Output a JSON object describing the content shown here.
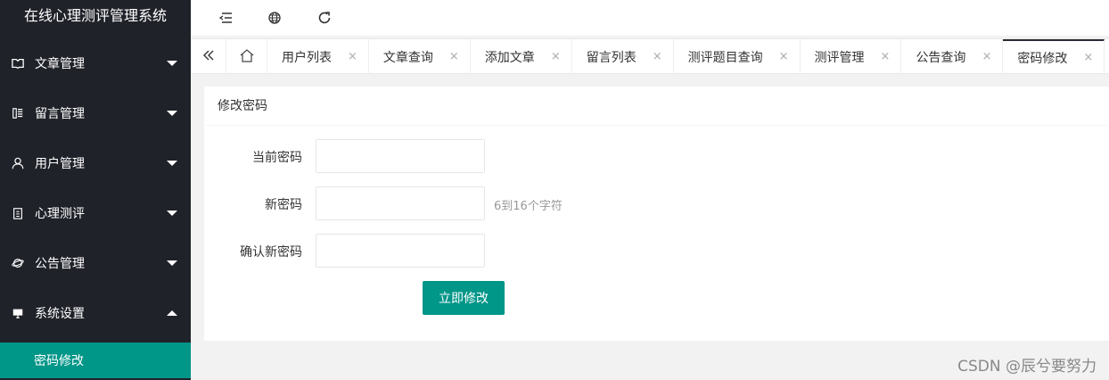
{
  "app": {
    "title": "在线心理测评管理系统"
  },
  "sidebar": {
    "items": [
      {
        "label": "文章管理",
        "icon": "book-icon"
      },
      {
        "label": "留言管理",
        "icon": "message-icon"
      },
      {
        "label": "用户管理",
        "icon": "user-icon"
      },
      {
        "label": "心理测评",
        "icon": "clipboard-icon"
      },
      {
        "label": "公告管理",
        "icon": "planet-icon"
      },
      {
        "label": "系统设置",
        "icon": "monitor-icon"
      }
    ],
    "active_sub": "密码修改"
  },
  "header": {
    "icons": [
      "menu-fold-icon",
      "globe-icon",
      "refresh-icon"
    ]
  },
  "tabs": [
    {
      "label": "用户列表"
    },
    {
      "label": "文章查询"
    },
    {
      "label": "添加文章"
    },
    {
      "label": "留言列表"
    },
    {
      "label": "测评题目查询"
    },
    {
      "label": "测评管理"
    },
    {
      "label": "公告查询"
    },
    {
      "label": "密码修改"
    }
  ],
  "tab_close": "×",
  "card": {
    "title": "修改密码",
    "fields": [
      {
        "label": "当前密码",
        "value": ""
      },
      {
        "label": "新密码",
        "value": "",
        "tip": "6到16个字符"
      },
      {
        "label": "确认新密码",
        "value": ""
      }
    ],
    "submit_label": "立即修改"
  },
  "watermark": "CSDN @辰兮要努力",
  "colors": {
    "accent": "#009688",
    "sidebar_bg": "#20222a"
  }
}
